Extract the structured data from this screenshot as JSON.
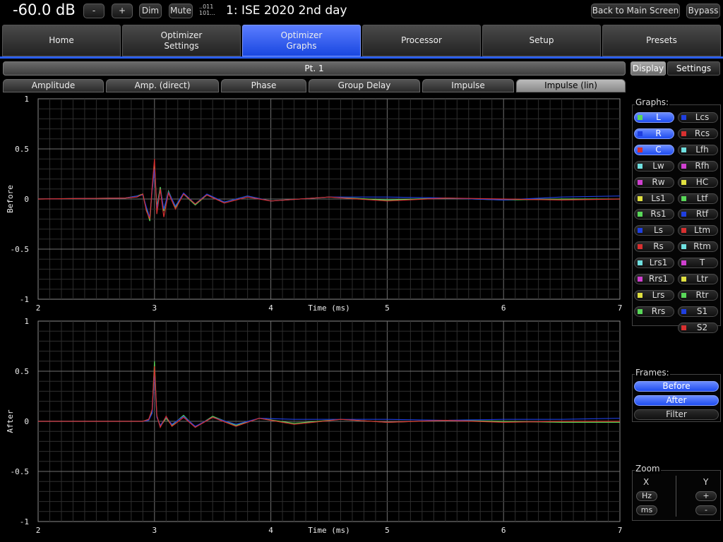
{
  "topbar": {
    "volume": "-60.0 dB",
    "minus": "-",
    "plus": "+",
    "dim": "Dim",
    "mute": "Mute",
    "format_line1": "..011",
    "format_line2": "101...",
    "preset_title": "1: ISE 2020 2nd day",
    "back_label": "Back to Main Screen",
    "bypass_label": "Bypass"
  },
  "tabs": [
    {
      "label": "Home"
    },
    {
      "label": "Optimizer\nSettings"
    },
    {
      "label": "Optimizer\nGraphs"
    },
    {
      "label": "Processor"
    },
    {
      "label": "Setup"
    },
    {
      "label": "Presets"
    }
  ],
  "point_label": "Pt. 1",
  "subtabs": [
    "Amplitude",
    "Amp. (direct)",
    "Phase",
    "Group Delay",
    "Impulse",
    "Impulse (lin)"
  ],
  "side_tabs": {
    "display": "Display",
    "settings": "Settings"
  },
  "graphs_title": "Graphs:",
  "channels_left": [
    {
      "name": "L",
      "color": "#59d859",
      "on": true
    },
    {
      "name": "R",
      "color": "#1f3fe0",
      "on": true
    },
    {
      "name": "C",
      "color": "#d83030",
      "on": true
    },
    {
      "name": "Lw",
      "color": "#6fe0e0",
      "on": false
    },
    {
      "name": "Rw",
      "color": "#d040d0",
      "on": false
    },
    {
      "name": "Ls1",
      "color": "#e0e040",
      "on": false
    },
    {
      "name": "Rs1",
      "color": "#59d859",
      "on": false
    },
    {
      "name": "Ls",
      "color": "#1f3fe0",
      "on": false
    },
    {
      "name": "Rs",
      "color": "#d83030",
      "on": false
    },
    {
      "name": "Lrs1",
      "color": "#6fe0e0",
      "on": false
    },
    {
      "name": "Rrs1",
      "color": "#d040d0",
      "on": false
    },
    {
      "name": "Lrs",
      "color": "#e0e040",
      "on": false
    },
    {
      "name": "Rrs",
      "color": "#59d859",
      "on": false
    }
  ],
  "channels_right": [
    {
      "name": "Lcs",
      "color": "#1f3fe0",
      "on": false
    },
    {
      "name": "Rcs",
      "color": "#d83030",
      "on": false
    },
    {
      "name": "Lfh",
      "color": "#6fe0e0",
      "on": false
    },
    {
      "name": "Rfh",
      "color": "#d040d0",
      "on": false
    },
    {
      "name": "HC",
      "color": "#e0e040",
      "on": false
    },
    {
      "name": "Ltf",
      "color": "#59d859",
      "on": false
    },
    {
      "name": "Rtf",
      "color": "#1f3fe0",
      "on": false
    },
    {
      "name": "Ltm",
      "color": "#d83030",
      "on": false
    },
    {
      "name": "Rtm",
      "color": "#6fe0e0",
      "on": false
    },
    {
      "name": "T",
      "color": "#d040d0",
      "on": false
    },
    {
      "name": "Ltr",
      "color": "#e0e040",
      "on": false
    },
    {
      "name": "Rtr",
      "color": "#59d859",
      "on": false
    },
    {
      "name": "S1",
      "color": "#1f3fe0",
      "on": false
    },
    {
      "name": "S2",
      "color": "#d83030",
      "on": false
    }
  ],
  "frames_title": "Frames:",
  "frames": [
    {
      "label": "Before",
      "on": true
    },
    {
      "label": "After",
      "on": true
    },
    {
      "label": "Filter",
      "on": false
    }
  ],
  "zoom": {
    "title": "Zoom",
    "x_label": "X",
    "y_label": "Y",
    "hz": "Hz",
    "ms": "ms",
    "y_plus": "+",
    "y_minus": "-"
  },
  "chart_data": [
    {
      "type": "line",
      "ylabel": "Before",
      "xlabel": "Time (ms)",
      "xlim": [
        2,
        7
      ],
      "ylim": [
        -1,
        1
      ],
      "xticks": [
        "2",
        "3",
        "4",
        "5",
        "6",
        "7"
      ],
      "yticks": [
        "1",
        "0.5",
        "0",
        "-0.5",
        "-1"
      ],
      "grid": true,
      "series": [
        {
          "name": "L",
          "color": "#59d859",
          "x": [
            2,
            2.75,
            2.85,
            2.9,
            2.93,
            2.96,
            2.98,
            3.0,
            3.02,
            3.05,
            3.08,
            3.12,
            3.18,
            3.25,
            3.35,
            3.45,
            3.6,
            3.8,
            4.0,
            4.5,
            5.0,
            5.5,
            6.0,
            6.5,
            7.0
          ],
          "y": [
            0,
            0.01,
            0.03,
            0.05,
            -0.1,
            -0.22,
            0.1,
            0.35,
            -0.08,
            0.12,
            -0.12,
            0.08,
            -0.08,
            0.05,
            -0.06,
            0.04,
            -0.03,
            0.03,
            -0.02,
            0.02,
            -0.01,
            0.01,
            -0.01,
            0.0,
            0.0
          ]
        },
        {
          "name": "R",
          "color": "#1f3fe0",
          "x": [
            2,
            2.75,
            2.85,
            2.9,
            2.93,
            2.96,
            2.98,
            3.0,
            3.02,
            3.05,
            3.08,
            3.12,
            3.18,
            3.25,
            3.35,
            3.45,
            3.6,
            3.8,
            4.0,
            4.5,
            5.0,
            5.5,
            6.0,
            6.5,
            7.0
          ],
          "y": [
            0,
            0.01,
            0.03,
            0.04,
            -0.08,
            -0.18,
            0.08,
            0.3,
            -0.1,
            0.1,
            -0.1,
            0.07,
            -0.07,
            0.06,
            -0.05,
            0.05,
            -0.03,
            0.03,
            -0.02,
            0.02,
            0.02,
            0.01,
            -0.01,
            0.02,
            0.03
          ]
        },
        {
          "name": "C",
          "color": "#d83030",
          "x": [
            2,
            2.75,
            2.85,
            2.9,
            2.93,
            2.96,
            2.98,
            3.0,
            3.02,
            3.05,
            3.08,
            3.12,
            3.18,
            3.25,
            3.35,
            3.45,
            3.6,
            3.8,
            4.0,
            4.5,
            5.0,
            5.5,
            6.0,
            6.5,
            7.0
          ],
          "y": [
            0,
            0.01,
            0.02,
            0.05,
            -0.12,
            -0.2,
            0.12,
            0.4,
            -0.15,
            0.1,
            -0.18,
            0.06,
            -0.1,
            0.05,
            -0.05,
            0.04,
            -0.04,
            0.02,
            -0.02,
            0.02,
            -0.02,
            0.01,
            0.0,
            -0.01,
            0.0
          ]
        }
      ]
    },
    {
      "type": "line",
      "ylabel": "After",
      "xlabel": "Time (ms)",
      "xlim": [
        2,
        7
      ],
      "ylim": [
        -1,
        1
      ],
      "xticks": [
        "2",
        "3",
        "4",
        "5",
        "6",
        "7"
      ],
      "yticks": [
        "1",
        "0.5",
        "0",
        "-0.5",
        "-1"
      ],
      "grid": true,
      "series": [
        {
          "name": "L",
          "color": "#59d859",
          "x": [
            2,
            2.9,
            2.95,
            2.98,
            3.0,
            3.02,
            3.05,
            3.1,
            3.15,
            3.25,
            3.35,
            3.5,
            3.7,
            3.9,
            4.2,
            4.6,
            5.0,
            5.5,
            6.0,
            6.5,
            7.0
          ],
          "y": [
            0,
            0.0,
            0.02,
            0.1,
            0.6,
            0.05,
            -0.05,
            0.03,
            -0.04,
            0.06,
            -0.06,
            0.05,
            -0.04,
            0.03,
            -0.02,
            0.02,
            -0.01,
            0.01,
            0.0,
            -0.01,
            -0.01
          ]
        },
        {
          "name": "R",
          "color": "#1f3fe0",
          "x": [
            2,
            2.9,
            2.95,
            2.98,
            3.0,
            3.02,
            3.05,
            3.1,
            3.15,
            3.25,
            3.35,
            3.5,
            3.7,
            3.9,
            4.2,
            4.6,
            5.0,
            5.5,
            6.0,
            6.5,
            7.0
          ],
          "y": [
            0,
            0.0,
            0.01,
            0.08,
            0.5,
            0.04,
            -0.04,
            0.04,
            -0.03,
            0.05,
            -0.05,
            0.04,
            -0.03,
            0.03,
            0.02,
            0.02,
            0.02,
            0.01,
            0.02,
            0.02,
            0.03
          ]
        },
        {
          "name": "C",
          "color": "#d83030",
          "x": [
            2,
            2.9,
            2.95,
            2.98,
            3.0,
            3.02,
            3.05,
            3.1,
            3.15,
            3.25,
            3.35,
            3.5,
            3.7,
            3.9,
            4.2,
            4.6,
            5.0,
            5.5,
            6.0,
            6.5,
            7.0
          ],
          "y": [
            0,
            0.0,
            0.02,
            0.12,
            0.55,
            0.06,
            -0.06,
            0.05,
            -0.05,
            0.04,
            -0.06,
            0.04,
            -0.05,
            0.03,
            -0.03,
            0.02,
            -0.01,
            0.01,
            -0.01,
            0.0,
            0.0
          ]
        }
      ]
    }
  ]
}
